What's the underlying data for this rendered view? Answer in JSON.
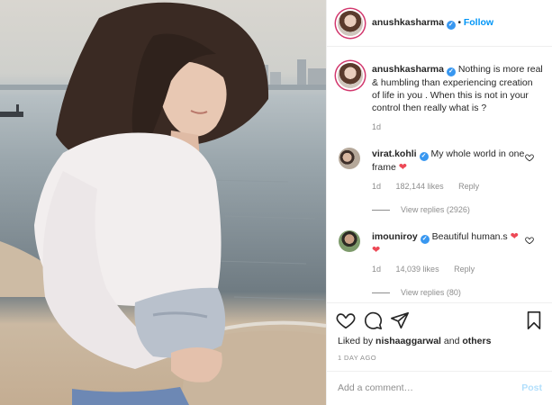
{
  "post": {
    "author": "anushkasharma",
    "follow_label": "Follow",
    "separator": "•",
    "caption": "Nothing is more real & humbling than experiencing creation of life in you . When this is not in your control then really what is ?",
    "caption_age": "1d"
  },
  "comments": [
    {
      "username": "virat.kohli",
      "text_part1": "My whole world in",
      "text_part2": "one frame",
      "heart": "❤",
      "age": "1d",
      "likes": "182,144 likes",
      "reply_label": "Reply",
      "view_replies": "View replies (2926)"
    },
    {
      "username": "imouniroy",
      "text_part1": "Beautiful human.s",
      "heart": "❤",
      "heart2": "❤",
      "age": "1d",
      "likes": "14,039 likes",
      "reply_label": "Reply",
      "view_replies": "View replies (80)"
    }
  ],
  "actions": {
    "liked_by_prefix": "Liked by",
    "liked_by_user": "nishaaggarwal",
    "liked_by_and": "and",
    "liked_by_others": "others",
    "timestamp": "1 DAY AGO"
  },
  "comment_box": {
    "placeholder": "Add a comment…",
    "post_label": "Post"
  },
  "colors": {
    "accent_blue": "#0095f6",
    "heart_red": "#ed4956",
    "muted_text": "#8e8e8e",
    "story_ring": "#d2386e"
  },
  "icons": [
    "heart-icon",
    "comment-icon",
    "share-icon",
    "bookmark-icon",
    "verified-badge-icon"
  ]
}
